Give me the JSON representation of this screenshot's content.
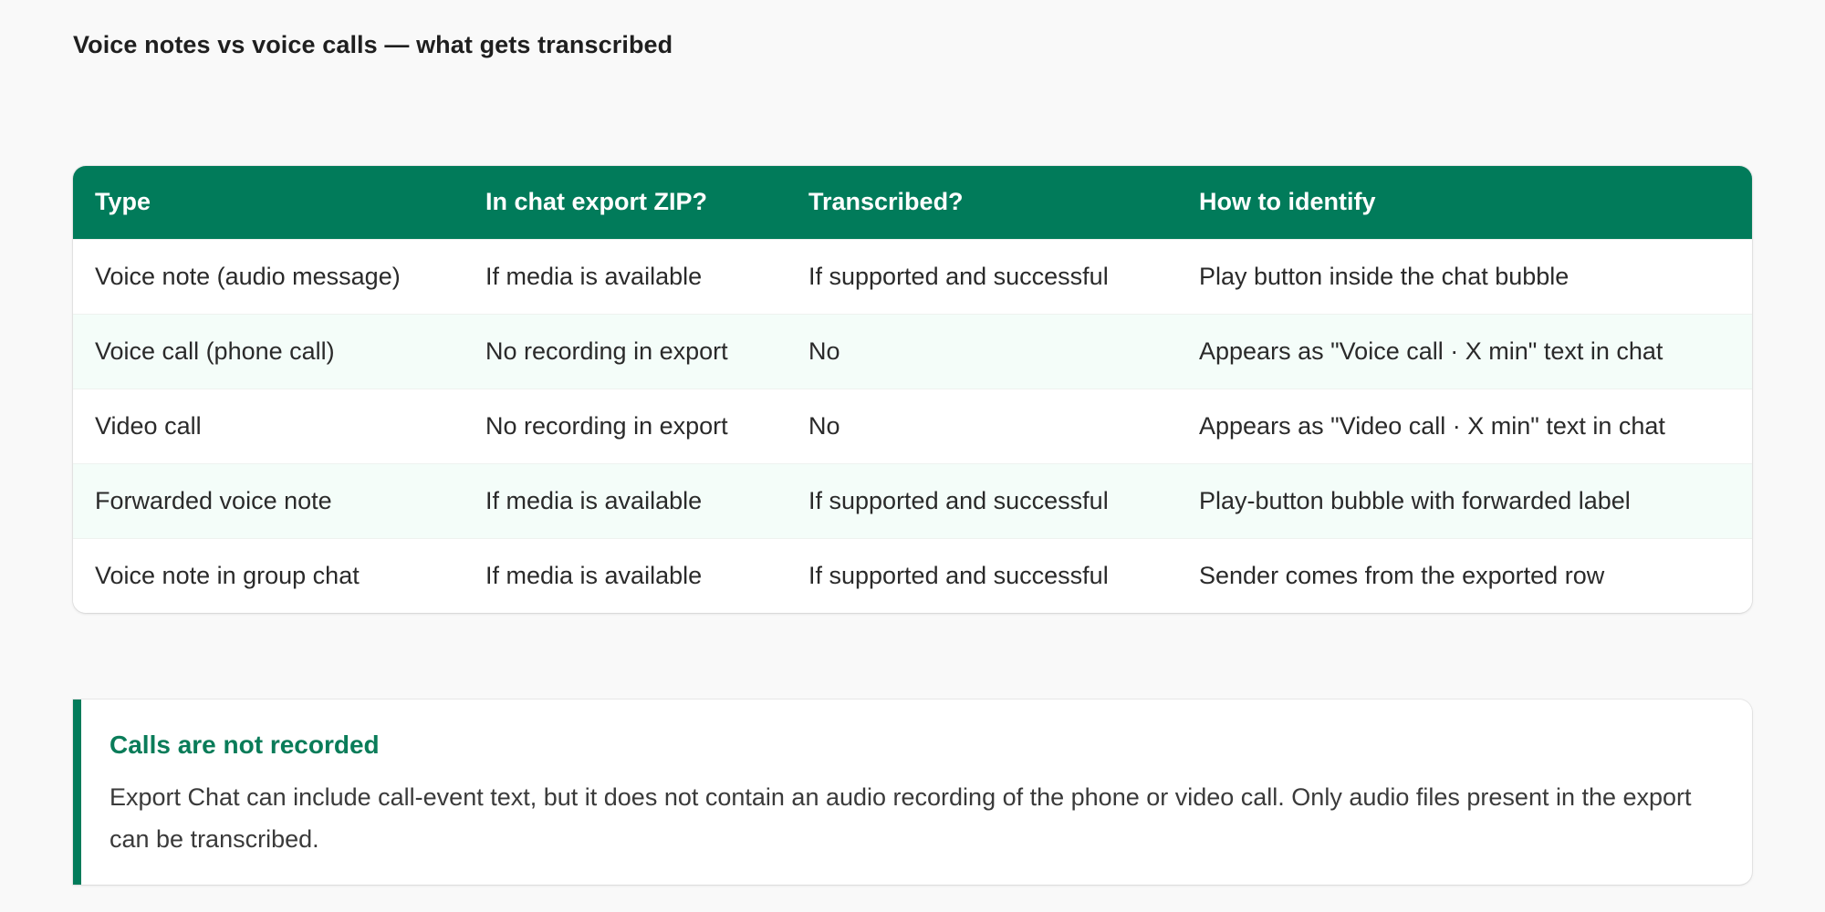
{
  "page": {
    "title": "Voice notes vs voice calls — what gets transcribed"
  },
  "colors": {
    "accent": "#017b5a",
    "row_alt": "#f4fdf9",
    "row_plain": "#ffffff",
    "callout_title": "#0a7c59"
  },
  "table": {
    "headers": [
      "Type",
      "In chat export ZIP?",
      "Transcribed?",
      "How to identify"
    ],
    "rows": [
      [
        "Voice note (audio message)",
        "If media is available",
        "If supported and successful",
        "Play button inside the chat bubble"
      ],
      [
        "Voice call (phone call)",
        "No recording in export",
        "No",
        "Appears as \"Voice call · X min\" text in chat"
      ],
      [
        "Video call",
        "No recording in export",
        "No",
        "Appears as \"Video call · X min\" text in chat"
      ],
      [
        "Forwarded voice note",
        "If media is available",
        "If supported and successful",
        "Play-button bubble with forwarded label"
      ],
      [
        "Voice note in group chat",
        "If media is available",
        "If supported and successful",
        "Sender comes from the exported row"
      ]
    ]
  },
  "callout": {
    "title": "Calls are not recorded",
    "body": "Export Chat can include call-event text, but it does not contain an audio recording of the phone or video call. Only audio files present in the export can be transcribed."
  }
}
